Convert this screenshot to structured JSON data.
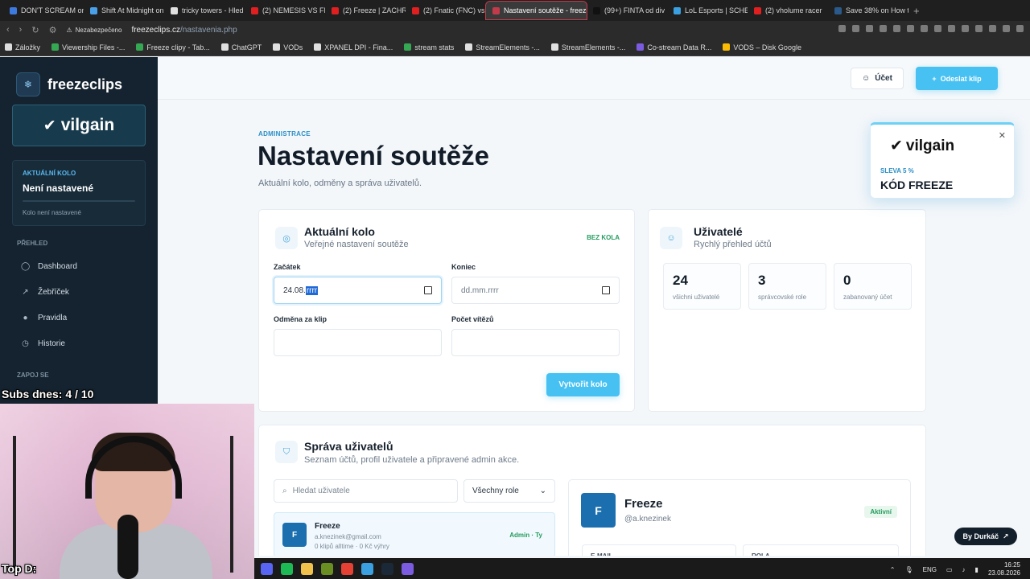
{
  "browser": {
    "tabs": [
      {
        "label": "DON'T SCREAM on",
        "color": "#3d7ae0"
      },
      {
        "label": "Shift At Midnight on",
        "color": "#4aa0e8"
      },
      {
        "label": "tricky towers - Hled",
        "color": "#e0e0e0"
      },
      {
        "label": "(2) NEMESIS VS FR",
        "color": "#e02020"
      },
      {
        "label": "(2) Freeze | ZACHR",
        "color": "#e02020"
      },
      {
        "label": "(2) Fnatic (FNC) vs",
        "color": "#e02020"
      },
      {
        "label": "Nastavení soutěže - freeze",
        "color": "#c23b4a",
        "active": true
      },
      {
        "label": "(99+) FINTA od div",
        "color": "#111111"
      },
      {
        "label": "LoL Esports | SCHE",
        "color": "#3aa0e0"
      },
      {
        "label": "(2) vholume racer",
        "color": "#e02020"
      },
      {
        "label": "Save 38% on How t",
        "color": "#2a5a8a"
      }
    ],
    "not_secure": "Nezabezpečeno",
    "url_host": "freezeclips.cz",
    "url_path": "/nastavenia.php",
    "bookmarks": [
      {
        "label": "Záložky",
        "color": "#dddddd"
      },
      {
        "label": "Viewership Files -...",
        "color": "#34a853"
      },
      {
        "label": "Freeze clipy - Tab...",
        "color": "#34a853"
      },
      {
        "label": "ChatGPT",
        "color": "#e0e0e0"
      },
      {
        "label": "VODs",
        "color": "#e0e0e0"
      },
      {
        "label": "XPANEL DPI - Fina...",
        "color": "#e0e0e0"
      },
      {
        "label": "stream stats",
        "color": "#34a853"
      },
      {
        "label": "StreamElements -...",
        "color": "#e0e0e0"
      },
      {
        "label": "StreamElements -...",
        "color": "#e0e0e0"
      },
      {
        "label": "Co-stream Data R...",
        "color": "#7b5ce0"
      },
      {
        "label": "VODS – Disk Google",
        "color": "#fbbc04"
      }
    ]
  },
  "sidebar": {
    "brand": "freezeclips",
    "sponsor": "vilgain",
    "round_label": "AKTUÁLNÍ KOLO",
    "round_value": "Není nastavené",
    "round_sub": "Kolo není nastavené",
    "section_overview": "PŘEHLED",
    "items": [
      {
        "label": "Dashboard",
        "icon": "◯"
      },
      {
        "label": "Žebříček",
        "icon": "↗"
      },
      {
        "label": "Pravidla",
        "icon": "●"
      },
      {
        "label": "Historie",
        "icon": "◷"
      }
    ],
    "section_join": "ZAPOJ SE"
  },
  "topbar": {
    "account": "Účet",
    "send_clip": "Odeslat klip"
  },
  "header": {
    "breadcrumb": "ADMINISTRACE",
    "title": "Nastavení soutěže",
    "subtitle": "Aktuální kolo, odměny a správa uživatelů."
  },
  "round_card": {
    "title": "Aktuální kolo",
    "subtitle": "Veřejné nastavení soutěže",
    "badge": "BEZ KOLA",
    "start_label": "Začátek",
    "start_value_prefix": "24.08.",
    "start_value_selected": "rrrr",
    "end_label": "Koniec",
    "end_placeholder": "dd.mm.rrrr",
    "reward_label": "Odměna za klip",
    "winners_label": "Počet vítězů",
    "create_button": "Vytvořit kolo"
  },
  "users_card": {
    "title": "Uživatelé",
    "subtitle": "Rychlý přehled účtů",
    "stats": [
      {
        "value": "24",
        "label": "všichni uživatelé"
      },
      {
        "value": "3",
        "label": "správcovské role"
      },
      {
        "value": "0",
        "label": "zabanovaný účet"
      }
    ]
  },
  "user_mgmt": {
    "title": "Správa uživatelů",
    "subtitle": "Seznam účtů, profil uživatele a připravené admin akce.",
    "search_placeholder": "Hledat uživatele",
    "role_filter": "Všechny role",
    "row": {
      "initial": "F",
      "name": "Freeze",
      "email": "a.knezinek@gmail.com",
      "meta": "0 klipů alltime · 0 Kč výhry",
      "role": "Admin · Ty"
    },
    "detail": {
      "initial": "F",
      "name": "Freeze",
      "handle": "@a.knezinek",
      "status": "Aktivní",
      "field1": "E-MAIL",
      "field2": "ROLA"
    }
  },
  "promo": {
    "brand": "vilgain",
    "discount": "SLEVA 5 %",
    "code": "KÓD FREEZE"
  },
  "badge_bottom": "By Durkáč",
  "overlay": {
    "subs": "Subs dnes: 4 / 10",
    "top": "Top D:"
  },
  "taskbar": {
    "lang": "ENG",
    "time": "16:25",
    "date": "23.08.2026",
    "icons": [
      {
        "name": "app-icon",
        "color": "#5865f2"
      },
      {
        "name": "spotify-icon",
        "color": "#1db954"
      },
      {
        "name": "files-icon",
        "color": "#f0c24b"
      },
      {
        "name": "media-icon",
        "color": "#6b8e23"
      },
      {
        "name": "chrome-icon",
        "color": "#e44134"
      },
      {
        "name": "app2-icon",
        "color": "#3aa0e0"
      },
      {
        "name": "steam-icon",
        "color": "#1b2838"
      },
      {
        "name": "grid-icon",
        "color": "#7b5ce0"
      }
    ]
  }
}
